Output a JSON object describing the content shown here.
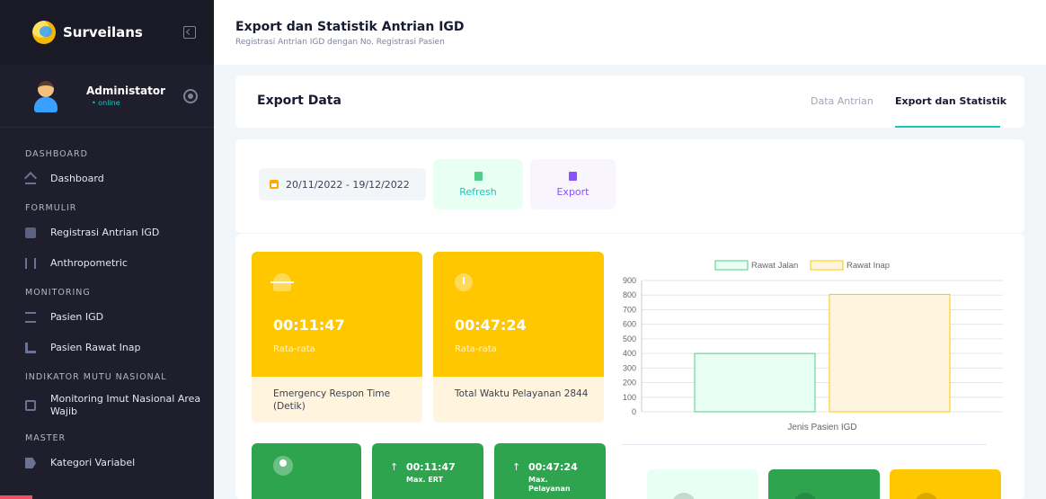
{
  "brand": {
    "name": "Surveilans"
  },
  "user": {
    "name": "Administator",
    "status": "• online"
  },
  "sidebar": {
    "sections": [
      {
        "title": "DASHBOARD",
        "items": [
          {
            "label": "Dashboard",
            "icon": "home-icon"
          }
        ]
      },
      {
        "title": "FORMULIR",
        "items": [
          {
            "label": "Registrasi Antrian IGD",
            "icon": "register-icon"
          },
          {
            "label": "Anthropometric",
            "icon": "tool-icon"
          }
        ]
      },
      {
        "title": "MONITORING",
        "items": [
          {
            "label": "Pasien IGD",
            "icon": "patient-icon"
          },
          {
            "label": "Pasien Rawat Inap",
            "icon": "bed-icon"
          }
        ]
      },
      {
        "title": "INDIKATOR MUTU NASIONAL",
        "items": [
          {
            "label": "Monitoring Imut Nasional Area Wajib",
            "icon": "monitor-icon"
          }
        ]
      },
      {
        "title": "MASTER",
        "items": [
          {
            "label": "Kategori Variabel",
            "icon": "tag-icon"
          }
        ]
      }
    ]
  },
  "header": {
    "title": "Export dan Statistik Antrian IGD",
    "subtitle": "Registrasi Antrian IGD dengan No. Registrasi Pasien"
  },
  "export_card": {
    "title": "Export Data",
    "tabs": [
      {
        "label": "Data Antrian"
      },
      {
        "label": "Export dan Statistik"
      }
    ]
  },
  "filter": {
    "date_range": "20/11/2022 - 19/12/2022",
    "refresh_label": "Refresh",
    "export_label": "Export"
  },
  "stats": {
    "ert": {
      "time": "00:11:47",
      "sub": "Rata-rata",
      "label": "Emergency Respon Time (Detik)"
    },
    "service": {
      "time": "00:47:24",
      "sub": "Rata-rata",
      "label": "Total Waktu Pelayanan 2844"
    },
    "max_ert": {
      "arrow": "↑",
      "time": "00:11:47",
      "label": "Max. ERT"
    },
    "max_service": {
      "arrow": "↑",
      "time": "00:47:24",
      "label": "Max. Pelayanan"
    }
  },
  "chart_data": {
    "type": "bar",
    "categories": [
      "Jenis Pasien IGD"
    ],
    "series": [
      {
        "name": "Rawat Jalan",
        "values": [
          400
        ],
        "fill": "#e8fff3",
        "stroke": "#50cd89"
      },
      {
        "name": "Rawat Inap",
        "values": [
          805
        ],
        "fill": "#fff4de",
        "stroke": "#ffc700"
      }
    ],
    "xlabel": "Jenis Pasien IGD",
    "ylim": [
      0,
      900
    ],
    "yticks": [
      0,
      100,
      200,
      300,
      400,
      500,
      600,
      700,
      800,
      900
    ],
    "grid": true,
    "legend": "top"
  },
  "colors": {
    "accent": "#1bc5bd",
    "yellow": "#ffc700",
    "green": "#2ea44f",
    "sidebar": "#1e1e2d"
  }
}
